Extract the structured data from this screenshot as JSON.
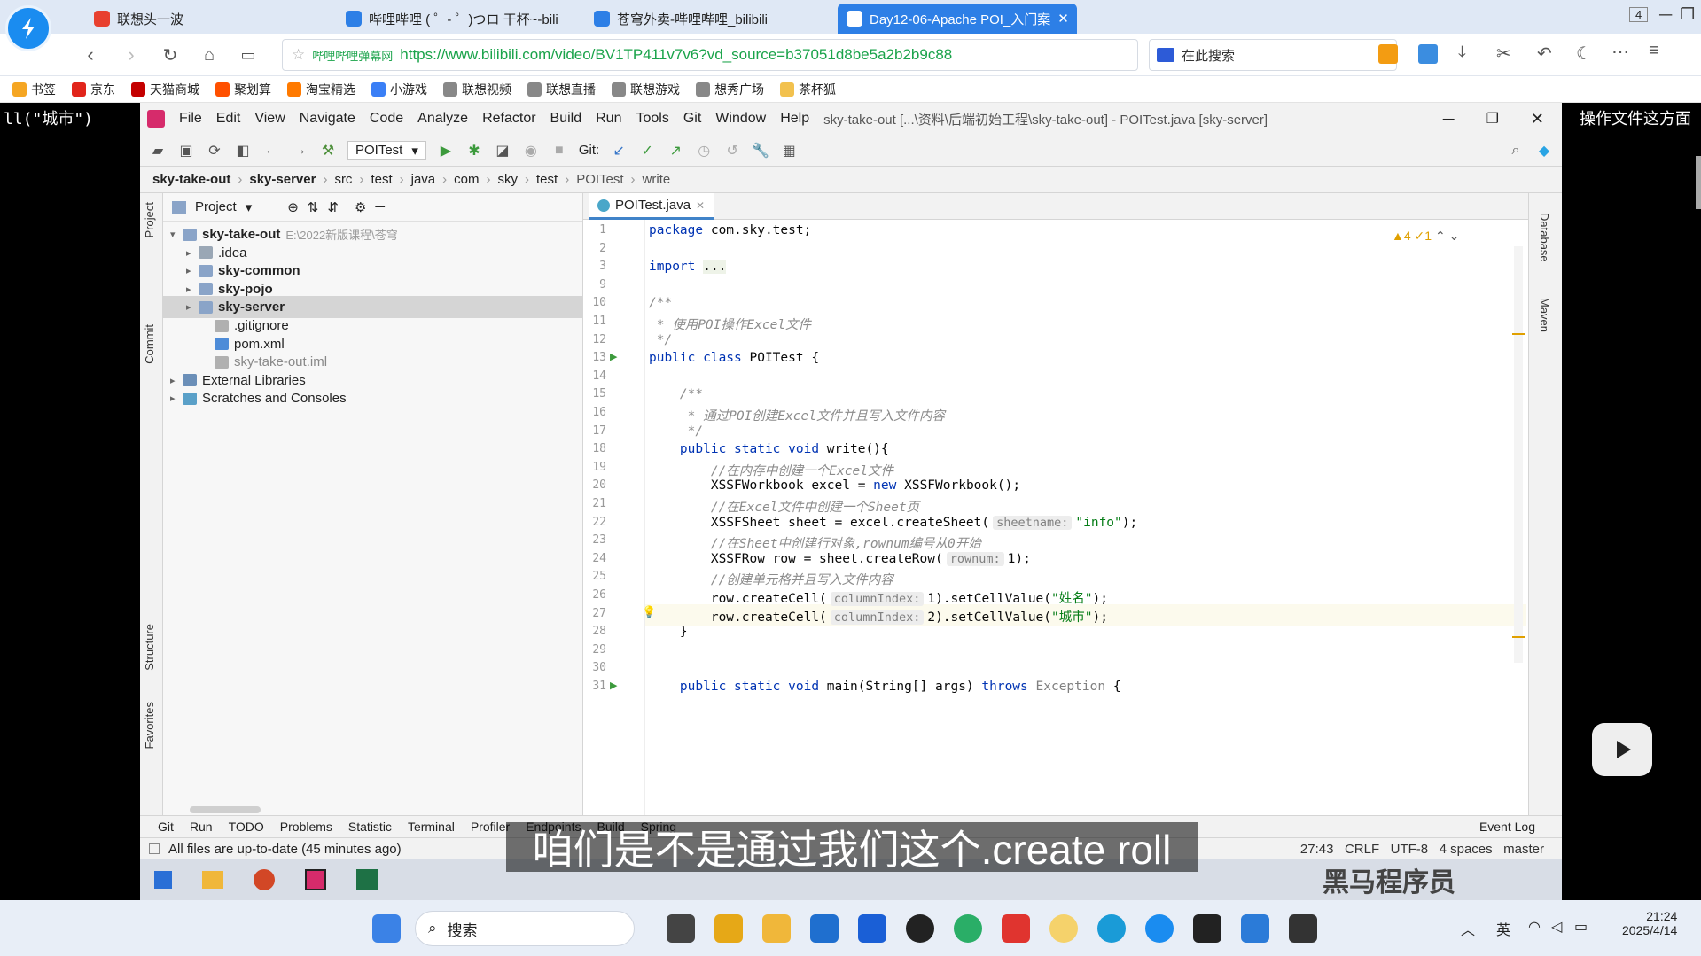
{
  "browser": {
    "tabs": [
      {
        "label": "联想头一波",
        "color": "#e8402f",
        "active": false
      },
      {
        "label": "哔哩哔哩 ( ゜- ゜)つロ 干杯~-bilib",
        "color": "#2d7fe6",
        "active": false
      },
      {
        "label": "苍穹外卖-哔哩哔哩_bilibili",
        "color": "#2d7fe6",
        "active": false
      },
      {
        "label": "Day12-06-Apache POI_入门案",
        "color": "#2d7fe6",
        "active": true
      }
    ],
    "tab_count": "4",
    "site_tag": "哔哩哔哩弹幕网",
    "url": "https://www.bilibili.com/video/BV1TP411v7v6?vd_source=b37051d8be5a2b2b9c88",
    "search_placeholder": "在此搜索",
    "bookmarks": [
      {
        "label": "书签",
        "color": "#f5a623"
      },
      {
        "label": "京东",
        "color": "#e1251b"
      },
      {
        "label": "天猫商城",
        "color": "#c40000"
      },
      {
        "label": "聚划算",
        "color": "#ff5000"
      },
      {
        "label": "淘宝精选",
        "color": "#ff7a00"
      },
      {
        "label": "小游戏",
        "color": "#3a7ff6"
      },
      {
        "label": "联想视频",
        "color": "#888888"
      },
      {
        "label": "联想直播",
        "color": "#888888"
      },
      {
        "label": "联想游戏",
        "color": "#888888"
      },
      {
        "label": "想秀广场",
        "color": "#888888"
      },
      {
        "label": "茶杯狐",
        "color": "#f2c14e"
      }
    ]
  },
  "overlay": {
    "left_text": "ll(\"城市\")",
    "right_text": "操作文件这方面"
  },
  "ide": {
    "menu": [
      "File",
      "Edit",
      "View",
      "Navigate",
      "Code",
      "Analyze",
      "Refactor",
      "Build",
      "Run",
      "Tools",
      "Git",
      "Window",
      "Help"
    ],
    "title": "sky-take-out [...\\资料\\后端初始工程\\sky-take-out] - POITest.java [sky-server]",
    "run_config": "POITest",
    "git_label": "Git:",
    "breadcrumbs": [
      "sky-take-out",
      "sky-server",
      "src",
      "test",
      "java",
      "com",
      "sky",
      "test",
      "POITest",
      "write"
    ],
    "project_label": "Project",
    "tree": [
      {
        "label": "sky-take-out",
        "extra": "E:\\2022新版课程\\苍穹",
        "bold": true,
        "indent": 0,
        "arrow": "▾",
        "icon": "#8aa4c8"
      },
      {
        "label": ".idea",
        "extra": "",
        "bold": false,
        "indent": 1,
        "arrow": "▸",
        "icon": "#9aa7b5"
      },
      {
        "label": "sky-common",
        "extra": "",
        "bold": true,
        "indent": 1,
        "arrow": "▸",
        "icon": "#8aa4c8"
      },
      {
        "label": "sky-pojo",
        "extra": "",
        "bold": true,
        "indent": 1,
        "arrow": "▸",
        "icon": "#8aa4c8"
      },
      {
        "label": "sky-server",
        "extra": "",
        "bold": true,
        "indent": 1,
        "arrow": "▸",
        "icon": "#8aa4c8",
        "selected": true
      },
      {
        "label": ".gitignore",
        "extra": "",
        "bold": false,
        "indent": 2,
        "arrow": "",
        "icon": "#b0b0b0"
      },
      {
        "label": "pom.xml",
        "extra": "",
        "bold": false,
        "indent": 2,
        "arrow": "",
        "icon": "#4e8cd8"
      },
      {
        "label": "sky-take-out.iml",
        "extra": "",
        "bold": false,
        "indent": 2,
        "arrow": "",
        "icon": "#b0b0b0",
        "dim": true
      },
      {
        "label": "External Libraries",
        "extra": "",
        "bold": false,
        "indent": 0,
        "arrow": "▸",
        "icon": "#6b8fb8"
      },
      {
        "label": "Scratches and Consoles",
        "extra": "",
        "bold": false,
        "indent": 0,
        "arrow": "▸",
        "icon": "#5aa0c8"
      }
    ],
    "editor_tab": "POITest.java",
    "warnings": "▲4 ✓1",
    "lines": [
      {
        "n": "1",
        "html": "<span class='kw'>package</span> com.sky.test;"
      },
      {
        "n": "2",
        "html": ""
      },
      {
        "n": "3",
        "html": "<span class='kw'>import</span> <span style='background:#eef3e8'>...</span>"
      },
      {
        "n": "9",
        "html": ""
      },
      {
        "n": "10",
        "html": "<span class='cm'>/**</span>"
      },
      {
        "n": "11",
        "html": "<span class='cm'> * 使用POI操作Excel文件</span>"
      },
      {
        "n": "12",
        "html": "<span class='cm'> */</span>"
      },
      {
        "n": "13",
        "html": "<span class='kw'>public class</span> POITest {"
      },
      {
        "n": "14",
        "html": ""
      },
      {
        "n": "15",
        "html": "    <span class='cm'>/**</span>"
      },
      {
        "n": "16",
        "html": "<span class='cm'>     * 通过POI创建Excel文件并且写入文件内容</span>"
      },
      {
        "n": "17",
        "html": "<span class='cm'>     */</span>"
      },
      {
        "n": "18",
        "html": "    <span class='kw'>public static void</span> write(){"
      },
      {
        "n": "19",
        "html": "        <span class='cm'>//在内存中创建一个Excel文件</span>"
      },
      {
        "n": "20",
        "html": "        XSSFWorkbook excel = <span class='kw'>new</span> XSSFWorkbook();"
      },
      {
        "n": "21",
        "html": "        <span class='cm'>//在Excel文件中创建一个Sheet页</span>"
      },
      {
        "n": "22",
        "html": "        XSSFSheet sheet = excel.createSheet(<span class='hint'>sheetname:</span><span class='str'>\"info\"</span>);"
      },
      {
        "n": "23",
        "html": "        <span class='cm'>//在Sheet中创建行对象,rownum编号从0开始</span>"
      },
      {
        "n": "24",
        "html": "        XSSFRow row = sheet.createRow(<span class='hint'>rownum:</span>1);"
      },
      {
        "n": "25",
        "html": "        <span class='cm'>//创建单元格并且写入文件内容</span>"
      },
      {
        "n": "26",
        "html": "        row.createCell(<span class='hint'>columnIndex:</span>1).setCellValue(<span class='str'>\"姓名\"</span>);"
      },
      {
        "n": "27",
        "html": "        row.createCell(<span class='hint'>columnIndex:</span>2).setCellValue(<span class='str'>\"城市\"</span>);"
      },
      {
        "n": "28",
        "html": "    }"
      },
      {
        "n": "29",
        "html": ""
      },
      {
        "n": "30",
        "html": ""
      },
      {
        "n": "31",
        "html": "    <span class='kw'>public static void</span> main(String[] args) <span class='kw'>throws</span> <span style='color:#808080'>Exception</span> {"
      }
    ],
    "right_strip": [
      "Database",
      "Maven"
    ],
    "left_strip": [
      "Project",
      "Commit",
      "Structure",
      "Favorites"
    ],
    "bottom_tabs": [
      "Git",
      "Run",
      "TODO",
      "Problems",
      "Statistic",
      "Terminal",
      "Profiler",
      "Endpoints",
      "Build",
      "Spring"
    ],
    "event_log": "Event Log",
    "status_text": "All files are up-to-date (45 minutes ago)",
    "status_right": "27:43   CRLF   UTF-8   4 spaces   master"
  },
  "subtitle": "咱们是不是通过我们这个.create roll",
  "watermark": "黑马程序员",
  "taskbar": {
    "search_label": "搜索",
    "ime": "英",
    "time": "21:24",
    "date": "2025/4/14"
  }
}
